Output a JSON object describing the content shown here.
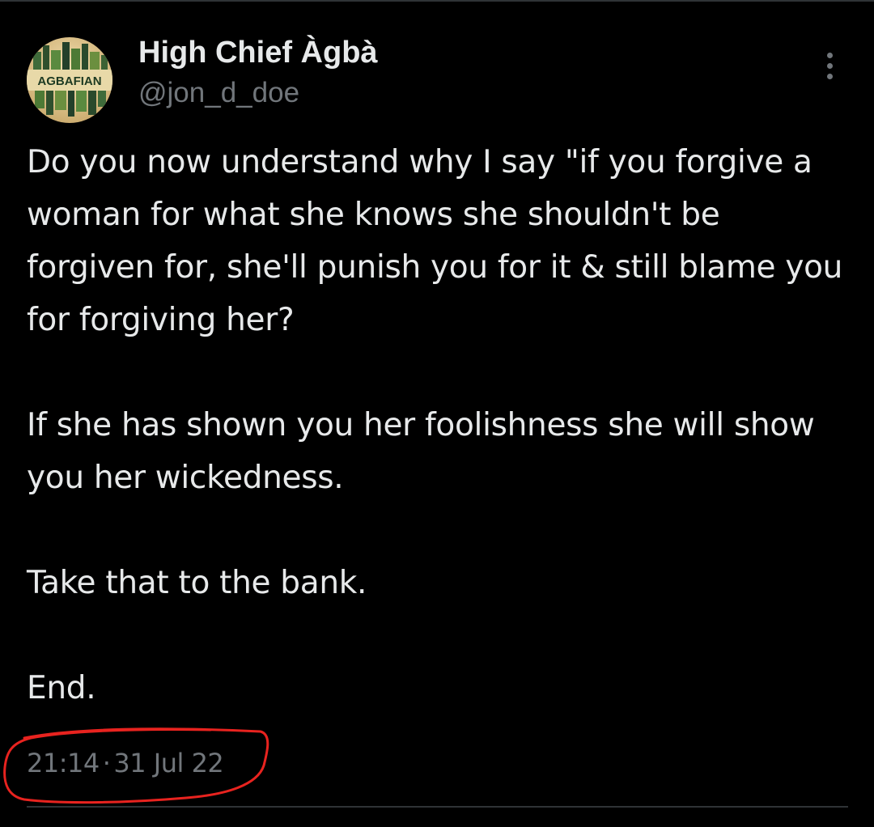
{
  "author": {
    "display_name": "High Chief Àgbà",
    "handle": "@jon_d_doe",
    "avatar_text": "AGBAFIAN"
  },
  "tweet": {
    "paragraphs": [
      "Do you now understand why I say \"if you forgive a woman for what she knows she shouldn't be forgiven for, she'll punish you for it & still blame you for forgiving her?",
      "If she has shown you her foolishness she will show you her wickedness.",
      "Take that to the bank.",
      "End."
    ],
    "time": "21:14",
    "separator": "·",
    "date": "31 Jul 22"
  },
  "annotation": {
    "color": "#e8231f"
  },
  "icons": {
    "more": "more-vertical-icon"
  }
}
